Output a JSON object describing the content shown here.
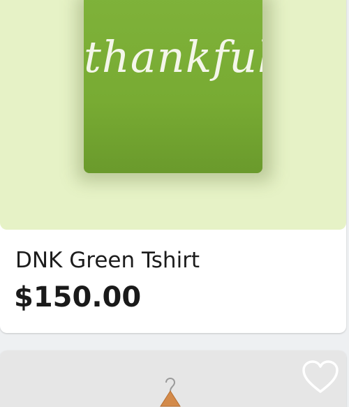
{
  "products": [
    {
      "name": "DNK Green Tshirt",
      "price": "$150.00",
      "image_text": "thankful"
    },
    {
      "favorite_icon": "heart-outline-icon",
      "image_icon": "hanger-icon"
    }
  ],
  "colors": {
    "card_background": "#ffffff",
    "image_background_1": "#e6f2c6",
    "shirt_green": "#78ab33",
    "image_background_2": "#e6e6e6"
  }
}
